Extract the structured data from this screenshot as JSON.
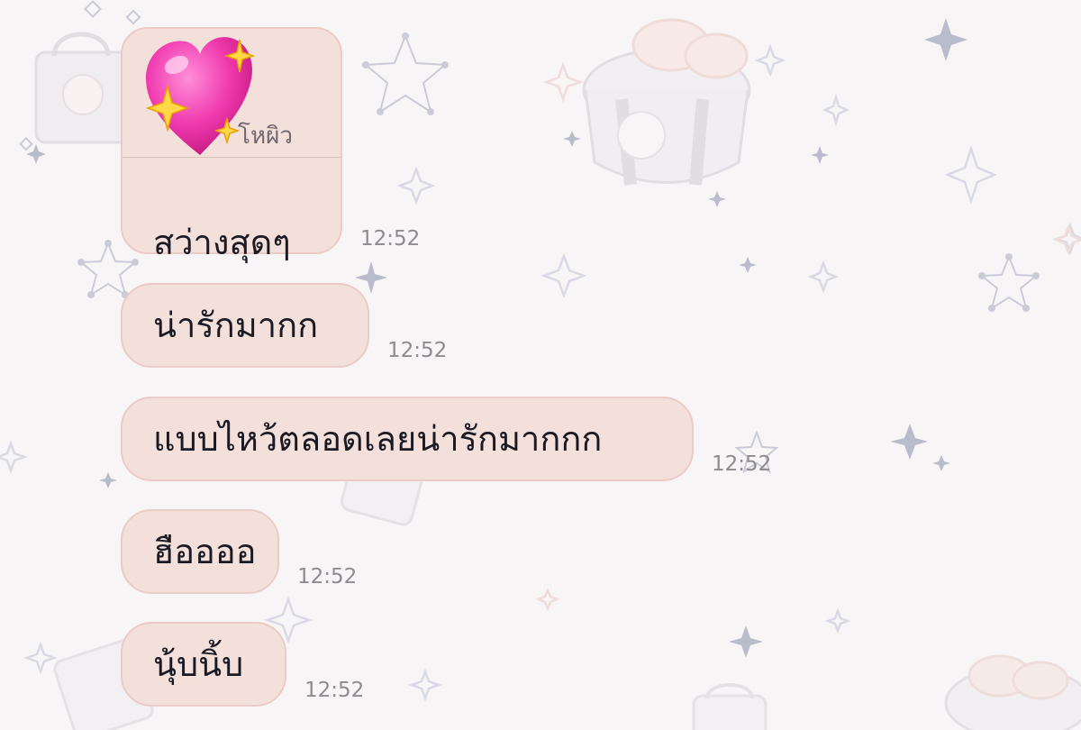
{
  "colors": {
    "background": "#f8f5f7",
    "bubble_fill": "#f4e0db",
    "bubble_border": "#ebcbc5",
    "message_text": "#1a1a24",
    "timestamp_text": "#8e8a90"
  },
  "messages": [
    {
      "reply_to": {
        "icon": "sparkling-heart-icon",
        "text": "โหผิว"
      },
      "text": "สว่างสุดๆ",
      "time": "12:52"
    },
    {
      "text": "น่ารักมากก",
      "time": "12:52"
    },
    {
      "text": "แบบไหว้ตลอดเลยน่ารักมากกก",
      "time": "12:52"
    },
    {
      "text": "ฮืออออ",
      "time": "12:52"
    },
    {
      "text": "นุ้บนิ้บ",
      "time": "12:52"
    }
  ]
}
